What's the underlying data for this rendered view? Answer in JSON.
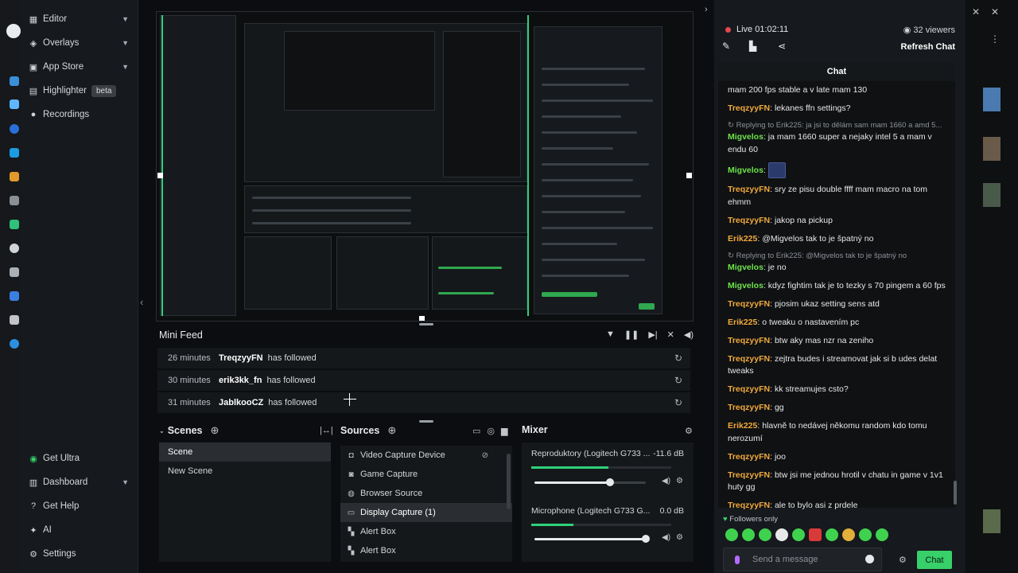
{
  "left_nav": {
    "items": [
      {
        "label": "Editor",
        "icon": "editor-icon",
        "chevron": true
      },
      {
        "label": "Overlays",
        "icon": "overlays-icon",
        "chevron": true
      },
      {
        "label": "App Store",
        "icon": "app-store-icon",
        "chevron": true
      },
      {
        "label": "Highlighter",
        "icon": "highlighter-icon",
        "badge": "beta"
      },
      {
        "label": "Recordings",
        "icon": "recordings-icon"
      }
    ],
    "bottom_items": [
      {
        "label": "Get Ultra",
        "icon": "ultra-icon"
      },
      {
        "label": "Dashboard",
        "icon": "dashboard-icon",
        "chevron": true
      },
      {
        "label": "Get Help",
        "icon": "help-icon"
      },
      {
        "label": "AI",
        "icon": "ai-icon"
      },
      {
        "label": "Settings",
        "icon": "settings-icon"
      }
    ]
  },
  "mini_feed": {
    "title": "Mini Feed",
    "rows": [
      {
        "time": "26 minutes",
        "user": "TreqzyyFN",
        "action": "has followed"
      },
      {
        "time": "30 minutes",
        "user": "erik3kk_fn",
        "action": "has followed"
      },
      {
        "time": "31 minutes",
        "user": "JablkooCZ",
        "action": "has followed"
      }
    ]
  },
  "scenes": {
    "title": "Scenes",
    "items": [
      "Scene",
      "New Scene"
    ],
    "selected": "Scene"
  },
  "sources": {
    "title": "Sources",
    "items": [
      {
        "label": "Video Capture Device",
        "icon": "camera-icon"
      },
      {
        "label": "Game Capture",
        "icon": "gamepad-icon"
      },
      {
        "label": "Browser Source",
        "icon": "globe-icon"
      },
      {
        "label": "Display Capture (1)",
        "icon": "monitor-icon"
      },
      {
        "label": "Alert Box",
        "icon": "widget-icon"
      },
      {
        "label": "Alert Box",
        "icon": "widget-icon"
      }
    ],
    "selected": "Display Capture (1)"
  },
  "mixer": {
    "title": "Mixer",
    "channels": [
      {
        "name": "Reproduktory (Logitech G733 ...",
        "db": "-11.6 dB",
        "level": 0.55,
        "volume": 0.68
      },
      {
        "name": "Microphone (Logitech G733 G...",
        "db": "0.0 dB",
        "level": 0.3,
        "volume": 1.0
      }
    ]
  },
  "chat_header": {
    "live": "Live 01:02:11",
    "viewers": "32 viewers",
    "refresh": "Refresh Chat"
  },
  "chat": {
    "title": "Chat",
    "messages": [
      {
        "user": "",
        "text": "mam 200 fps stable a v late mam 130"
      },
      {
        "user": "TreqzyyFN",
        "text": "lekanes ffn settings?"
      },
      {
        "reply": "Replying to Erik225: ja jsi to dělám sam mam 1660 a amd 5..."
      },
      {
        "user": "Migvelos",
        "text": "ja mam 1660 super a nejaky intel 5 a mam v endu 60"
      },
      {
        "user": "Migvelos",
        "text": "",
        "emote": true
      },
      {
        "user": "TreqzyyFN",
        "text": "sry ze pisu double ffff mam macro na tom ehmm"
      },
      {
        "user": "TreqzyyFN",
        "text": "jakop na pickup"
      },
      {
        "user": "Erik225",
        "text": "@Migvelos tak to je špatný no"
      },
      {
        "reply": "Replying to Erik225: @Migvelos tak to je špatný no"
      },
      {
        "user": "Migvelos",
        "text": "je no"
      },
      {
        "user": "Migvelos",
        "text": "kdyz fightim tak je to tezky s 70 pingem a 60 fps"
      },
      {
        "user": "TreqzyyFN",
        "text": "pjosim ukaz setting sens atd"
      },
      {
        "user": "Erik225",
        "text": "o tweaku o nastavením pc"
      },
      {
        "user": "TreqzyyFN",
        "text": "btw aky mas nzr na zeniho"
      },
      {
        "user": "TreqzyyFN",
        "text": "zejtra budes i streamovat jak si b udes delat tweaks"
      },
      {
        "user": "TreqzyyFN",
        "text": "kk streamujes csto?"
      },
      {
        "user": "TreqzyyFN",
        "text": "gg"
      },
      {
        "user": "Erik225",
        "text": "hlavně to nedávej někomu random kdo tomu nerozumí"
      },
      {
        "user": "TreqzyyFN",
        "text": "joo"
      },
      {
        "user": "TreqzyyFN",
        "text": "btw jsi me jednou hrotil v chatu in game v 1v1 huty gg"
      },
      {
        "user": "TreqzyyFN",
        "text": "ale to bylo asi z prdele"
      }
    ],
    "followers_only": "Followers only",
    "input_placeholder": "Send a message",
    "send_label": "Chat"
  },
  "colors": {
    "accent_green": "#37d06a",
    "username_orange": "#f2a93b",
    "username_green": "#6ee24b",
    "live_red": "#e5484d"
  }
}
